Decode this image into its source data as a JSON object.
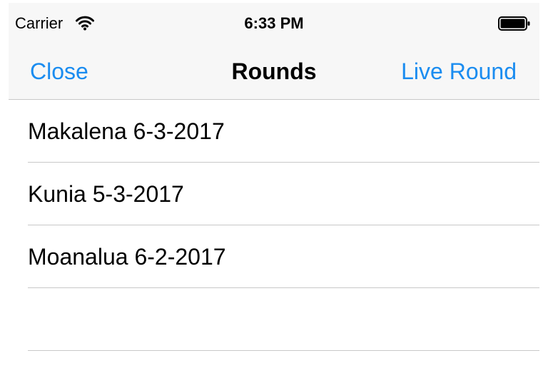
{
  "status_bar": {
    "carrier": "Carrier",
    "time": "6:33 PM",
    "wifi_icon": "wifi-icon",
    "battery_icon": "battery-full-icon"
  },
  "nav": {
    "left_label": "Close",
    "title": "Rounds",
    "right_label": "Live Round",
    "tint_color": "#1a8cf0"
  },
  "rounds": [
    {
      "label": "Makalena 6-3-2017"
    },
    {
      "label": "Kunia 5-3-2017"
    },
    {
      "label": "Moanalua 6-2-2017"
    },
    {
      "label": ""
    }
  ]
}
